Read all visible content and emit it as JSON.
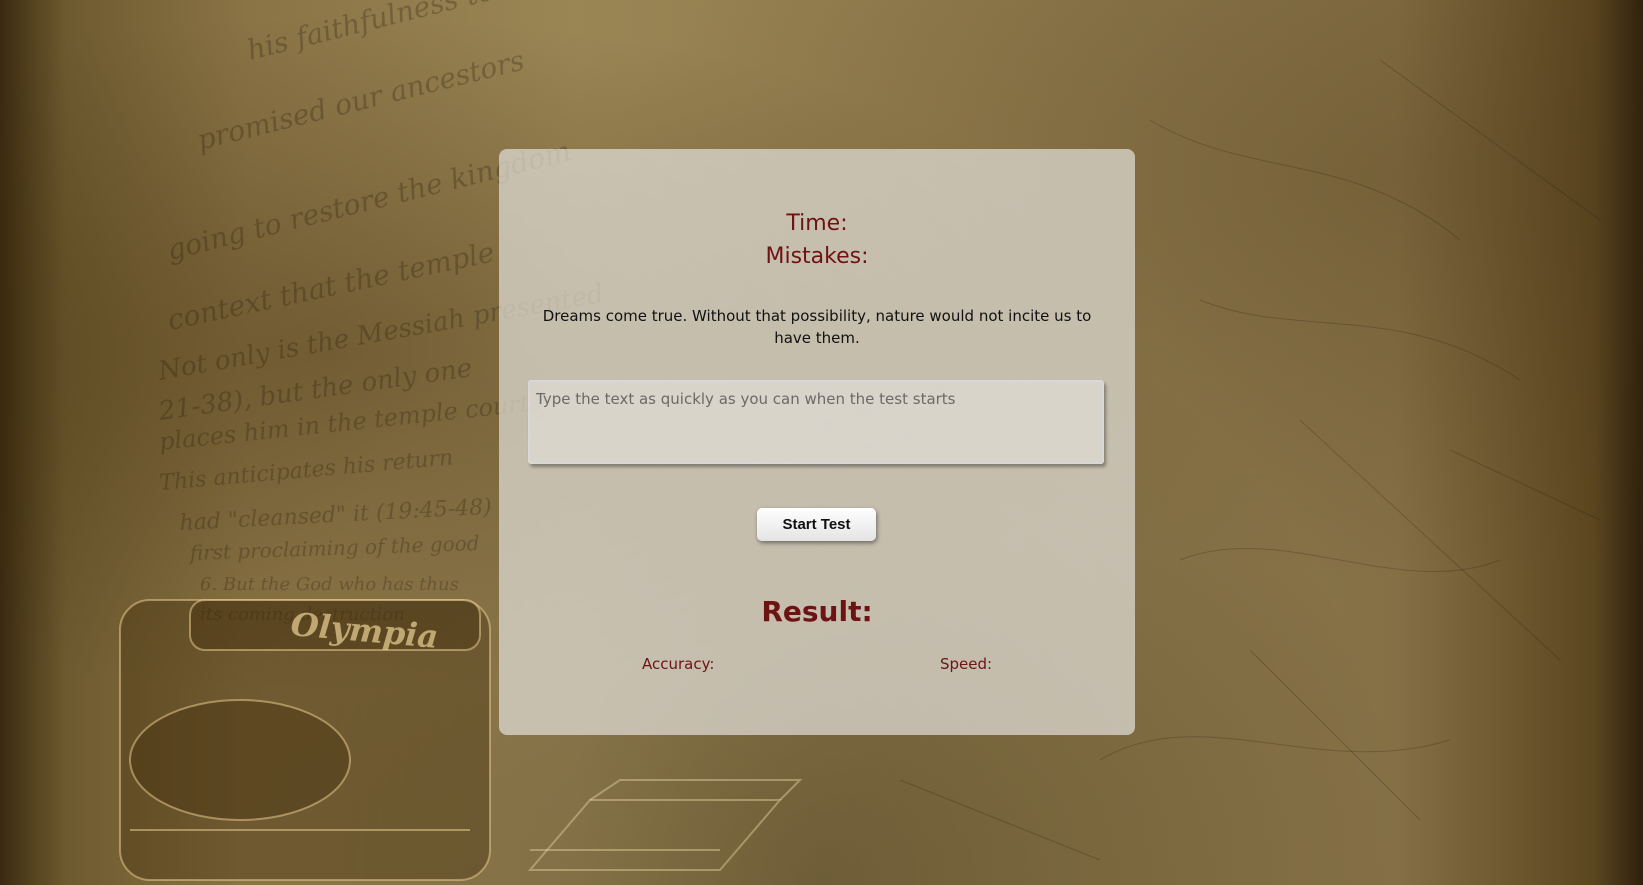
{
  "stats": {
    "time_label": "Time:",
    "mistakes_label": "Mistakes:"
  },
  "quote": {
    "text": "Dreams come true. Without that possibility, nature would not incite us to have them."
  },
  "input": {
    "placeholder": "Type the text as quickly as you can when the test starts",
    "value": ""
  },
  "controls": {
    "start_label": "Start Test"
  },
  "result": {
    "title": "Result:",
    "accuracy_label": "Accuracy:",
    "speed_label": "Speed:"
  },
  "colors": {
    "accent": "#6e1313",
    "panel": "#e1ded7"
  }
}
